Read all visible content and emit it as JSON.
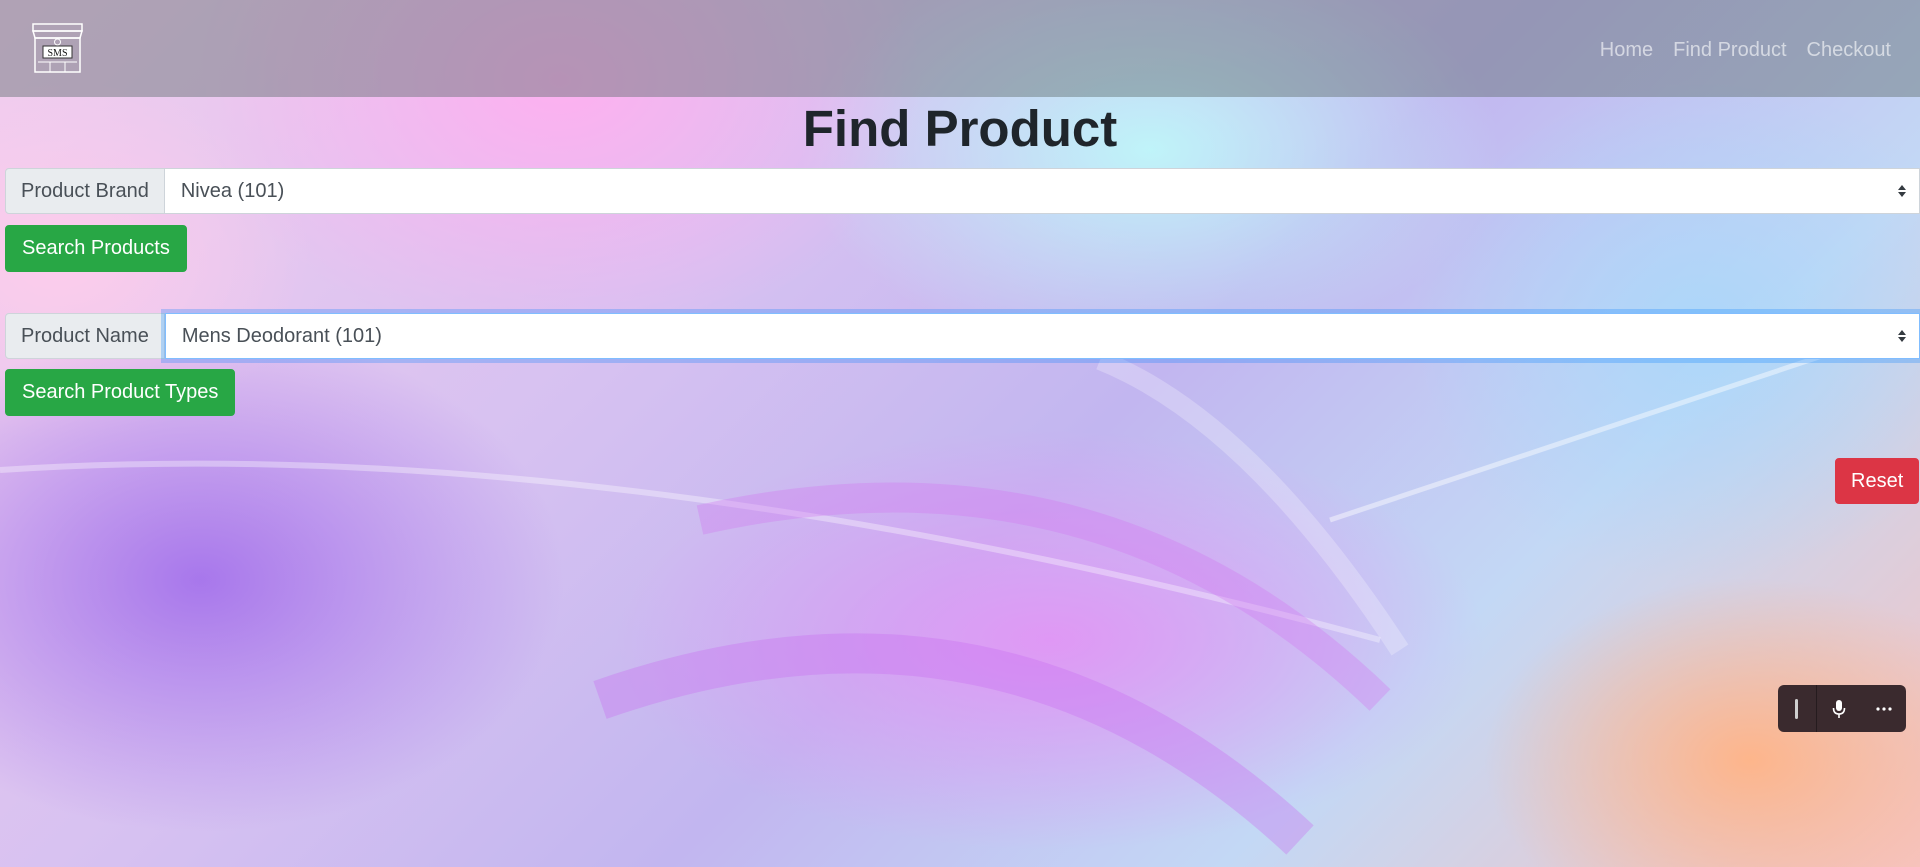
{
  "navbar": {
    "brand_text": "SMS",
    "links": [
      {
        "label": "Home"
      },
      {
        "label": "Find Product"
      },
      {
        "label": "Checkout"
      }
    ]
  },
  "page": {
    "title": "Find Product"
  },
  "brand_filter": {
    "label": "Product Brand",
    "selected": "Nivea (101)"
  },
  "search_products_button": {
    "label": "Search Products"
  },
  "name_filter": {
    "label": "Product Name",
    "selected": "Mens Deodorant (101)"
  },
  "search_types_button": {
    "label": "Search Product Types"
  },
  "reset_button": {
    "label": "Reset"
  },
  "voice_toolbar": {
    "icons": [
      "drag-handle-icon",
      "microphone-icon",
      "more-options-icon"
    ]
  },
  "colors": {
    "success": "#28a745",
    "danger": "#dc3545",
    "focus_ring": "#80bdff"
  }
}
